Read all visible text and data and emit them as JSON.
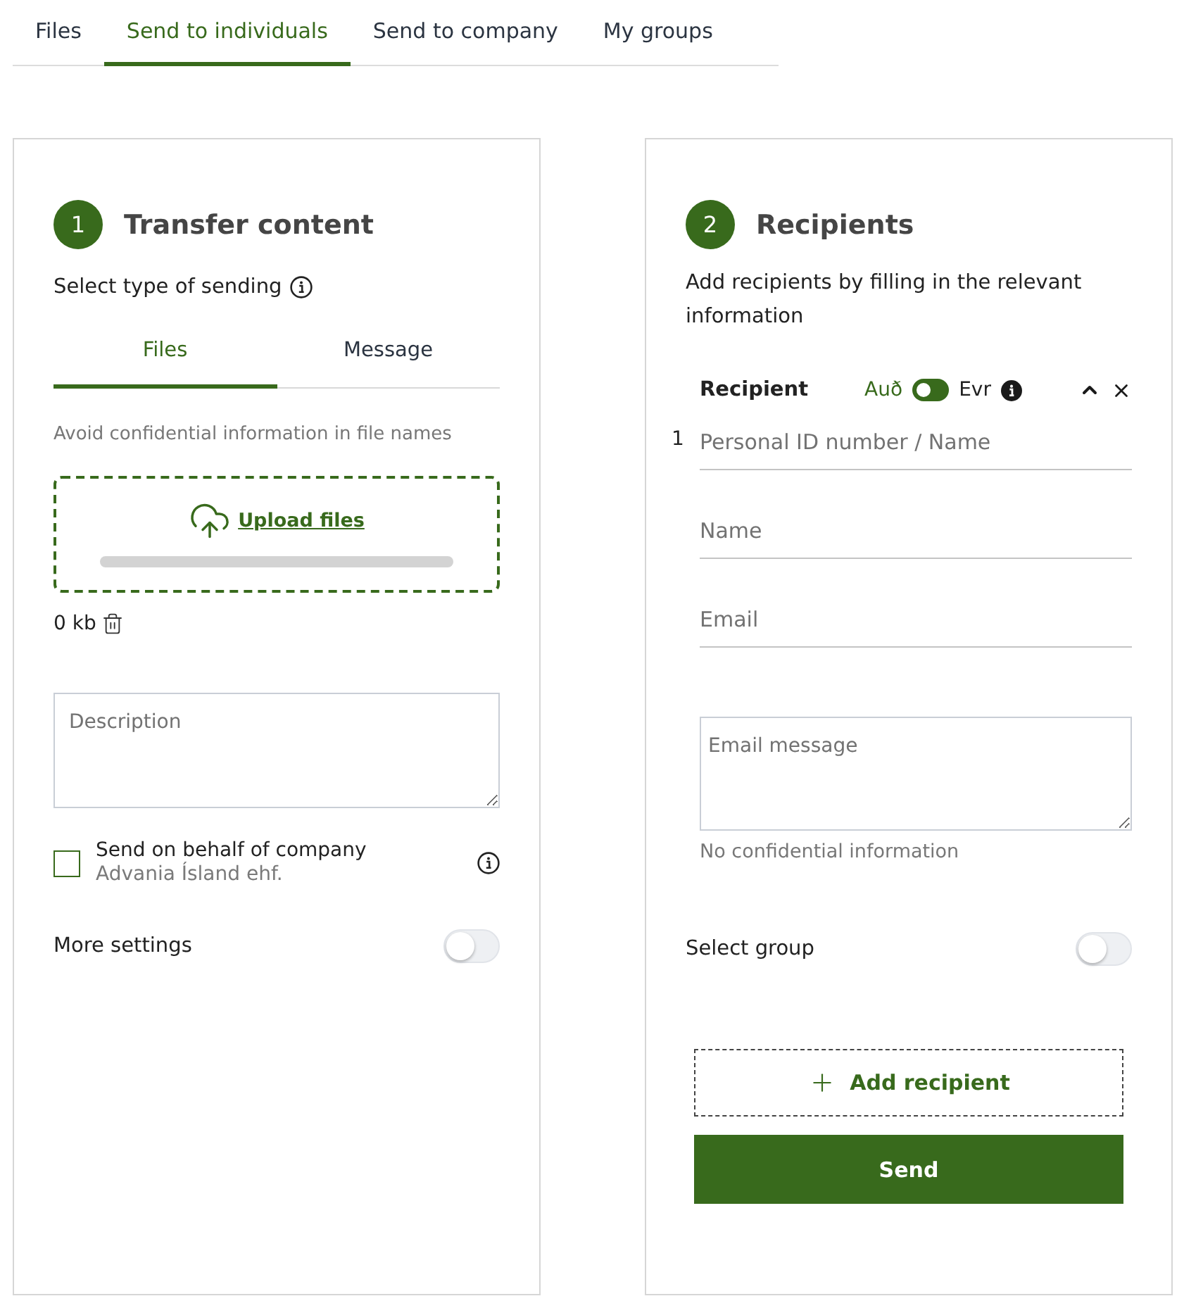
{
  "tabs": [
    {
      "label": "Files",
      "selected": false
    },
    {
      "label": "Send to individuals",
      "selected": true
    },
    {
      "label": "Send to company",
      "selected": false
    },
    {
      "label": "My groups",
      "selected": false
    }
  ],
  "transfer": {
    "step": "1",
    "title": "Transfer content",
    "type_label": "Select type of sending",
    "type_tabs": [
      {
        "label": "Files",
        "selected": true
      },
      {
        "label": "Message",
        "selected": false
      }
    ],
    "notice": "Avoid confidential information in file names",
    "upload": {
      "label": "Upload files",
      "level": 0
    },
    "size": "0 kb",
    "description": {
      "placeholder": "Description"
    },
    "behalf": {
      "label": "Send on behalf of company",
      "company": "Advania Ísland ehf.",
      "checked": false
    },
    "more_settings": {
      "label": "More settings",
      "on": false
    }
  },
  "recipients": {
    "step": "2",
    "title": "Recipients",
    "intro": "Add recipients by filling in the relevant information",
    "recipient": {
      "title": "Recipient",
      "id_options": [
        {
          "label": "Auð",
          "selected": true
        },
        {
          "label": "Evr",
          "selected": false
        }
      ],
      "expanded": true,
      "number": "1",
      "fields": [
        {
          "placeholder": "Personal ID number / Name"
        },
        {
          "placeholder": "Name"
        },
        {
          "placeholder": "Email"
        }
      ],
      "message": {
        "placeholder": "Email message",
        "hint": "No confidential information"
      }
    },
    "select_group": {
      "label": "Select group",
      "on": false
    },
    "add_label": "Add recipient",
    "send_label": "Send"
  }
}
